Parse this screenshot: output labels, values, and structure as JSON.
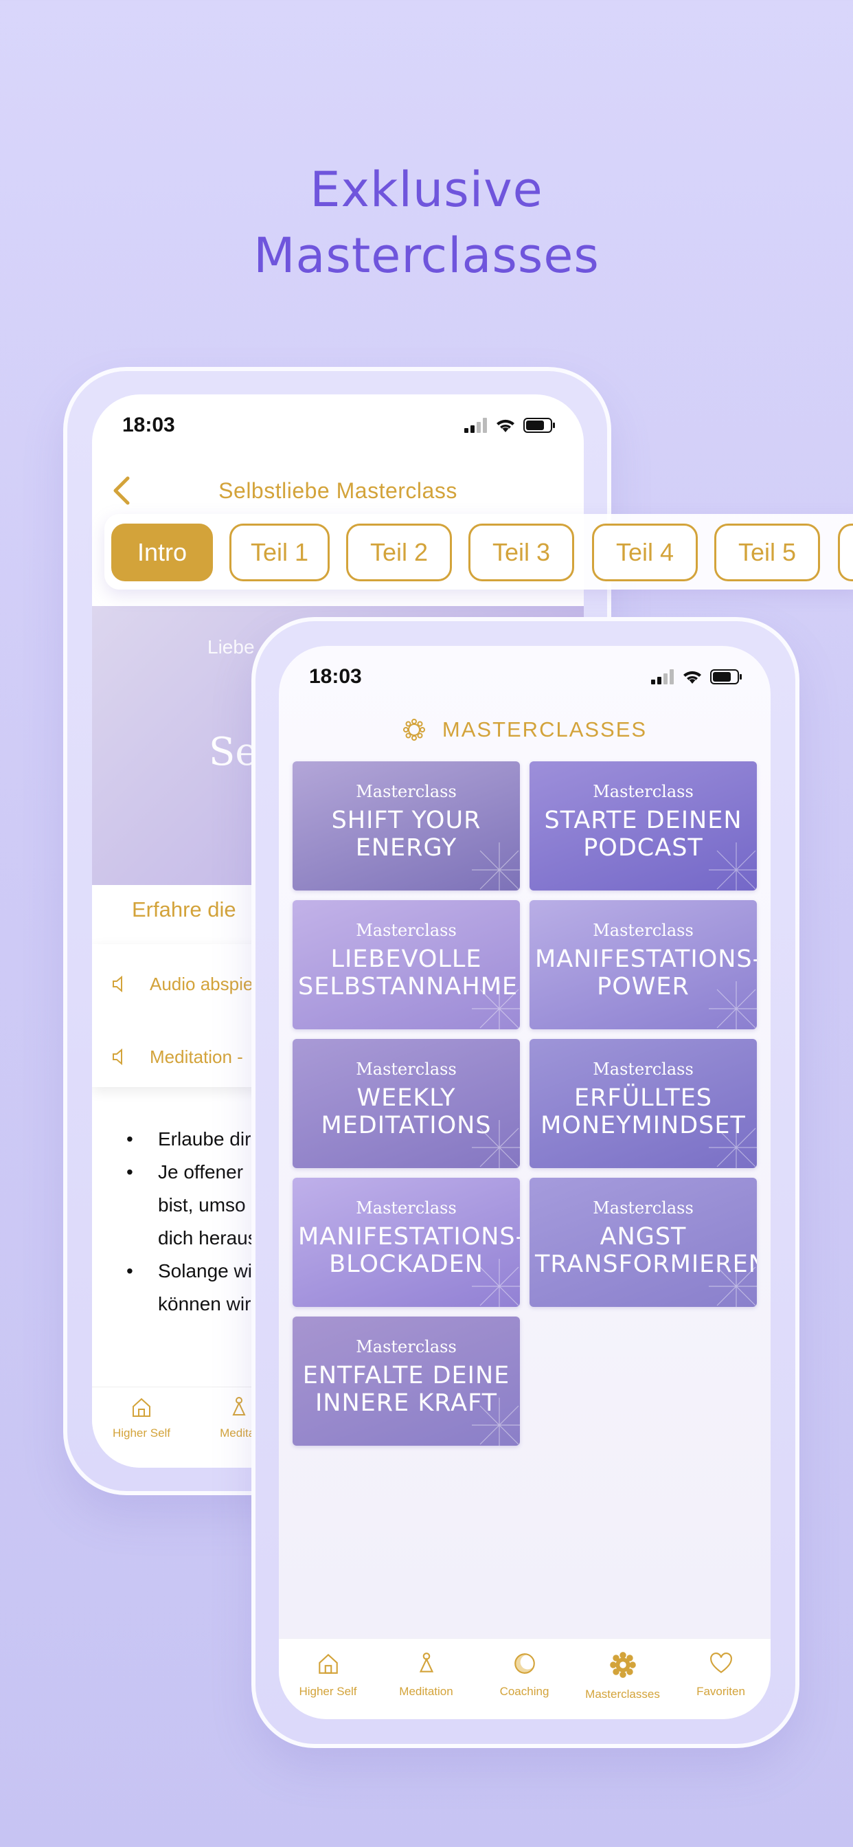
{
  "headline": {
    "line1": "Exklusive",
    "line2": "Masterclasses"
  },
  "colors": {
    "gold": "#d3a33a",
    "purple": "#6f55dc"
  },
  "back_phone": {
    "time": "18:03",
    "nav_title": "Selbstliebe Masterclass",
    "parts": [
      "Intro",
      "Teil 1",
      "Teil 2",
      "Teil 3",
      "Teil 4",
      "Teil 5"
    ],
    "active_part": "Intro",
    "hero_sub": "Liebe",
    "hero_title": "Selb",
    "experience": "Erfahre die",
    "audio_items": [
      "Audio abspie",
      "Meditation -"
    ],
    "bullets": [
      {
        "lines": [
          "Erlaube dir, "
        ]
      },
      {
        "lines": [
          "Je offener",
          "bist, umso",
          "dich heraus"
        ]
      },
      {
        "lines": [
          "Solange wir",
          "können wir n"
        ]
      }
    ],
    "tabs": [
      {
        "label": "Higher Self",
        "icon": "home-icon"
      },
      {
        "label": "Meditat",
        "icon": "meditation-icon"
      }
    ]
  },
  "front_phone": {
    "time": "18:03",
    "header_title": "MASTERCLASSES",
    "cards": [
      {
        "kicker": "Masterclass",
        "title": "SHIFT YOUR ENERGY",
        "bg": [
          "#b3a6d8",
          "#7d72b8"
        ]
      },
      {
        "kicker": "Masterclass",
        "title": "STARTE DEINEN PODCAST",
        "bg": [
          "#9d8fda",
          "#7468c8"
        ]
      },
      {
        "kicker": "Masterclass",
        "title": "LIEBEVOLLE SELBSTANNAHME",
        "bg": [
          "#c2b2e8",
          "#9c8bd6"
        ]
      },
      {
        "kicker": "Masterclass",
        "title": "MANIFESTATIONS-POWER",
        "bg": [
          "#b9aee6",
          "#8b7fd0"
        ]
      },
      {
        "kicker": "Masterclass",
        "title": "WEEKLY MEDITATIONS",
        "bg": [
          "#a99ad6",
          "#8577c2"
        ]
      },
      {
        "kicker": "Masterclass",
        "title": "ERFÜLLTES MONEYMINDSET",
        "bg": [
          "#9e95d8",
          "#7a70c6"
        ]
      },
      {
        "kicker": "Masterclass",
        "title": "MANIFESTATIONS-BLOCKADEN",
        "bg": [
          "#bfb0ea",
          "#9281d4"
        ]
      },
      {
        "kicker": "Masterclass",
        "title": "ANGST TRANSFORMIEREN",
        "bg": [
          "#a59bdc",
          "#8a80cc"
        ]
      },
      {
        "kicker": "Masterclass",
        "title": "ENTFALTE DEINE INNERE KRAFT",
        "bg": [
          "#a795d0",
          "#8b7fc8"
        ]
      }
    ],
    "tabs": [
      {
        "label": "Higher Self",
        "icon": "home-icon"
      },
      {
        "label": "Meditation",
        "icon": "meditation-icon"
      },
      {
        "label": "Coaching",
        "icon": "moon-icon"
      },
      {
        "label": "Masterclasses",
        "icon": "flower-icon"
      },
      {
        "label": "Favoriten",
        "icon": "heart-icon"
      }
    ]
  }
}
